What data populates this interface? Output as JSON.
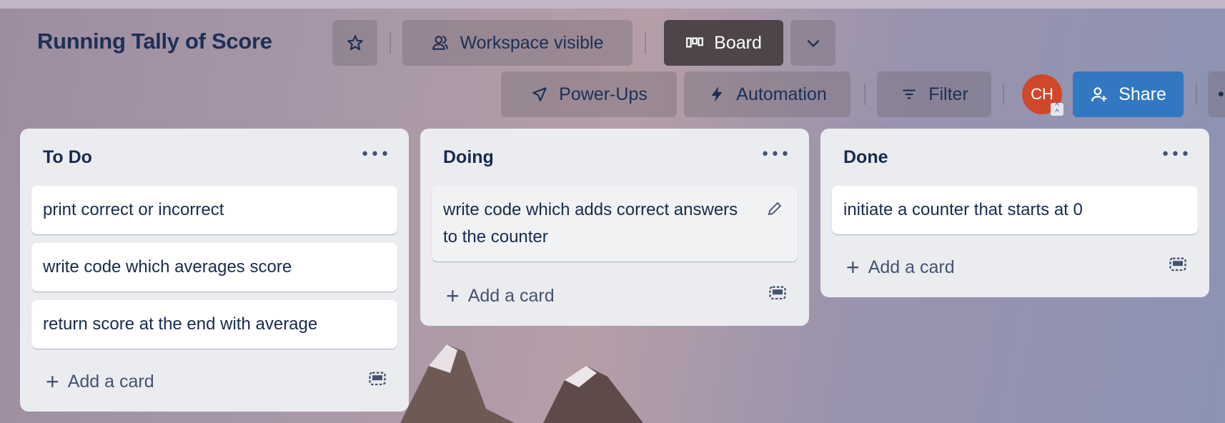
{
  "board": {
    "title": "Running Tally of Score"
  },
  "header": {
    "star_icon": "star-icon",
    "visibility_label": "Workspace visible",
    "view_label": "Board",
    "powerups_label": "Power-Ups",
    "automation_label": "Automation",
    "filter_label": "Filter",
    "avatar_initials": "CH",
    "share_label": "Share",
    "colors": {
      "share": "#3278c0",
      "avatar": "#d0482a",
      "view": "#4d4549"
    }
  },
  "lists": [
    {
      "title": "To Do",
      "cards": [
        "print correct or incorrect",
        "write code which averages score",
        "return score at the end with average"
      ],
      "add_label": "Add a card"
    },
    {
      "title": "Doing",
      "cards": [
        "write code which adds correct answers to the counter"
      ],
      "add_label": "Add a card"
    },
    {
      "title": "Done",
      "cards": [
        "initiate a counter that starts at 0"
      ],
      "add_label": "Add a card"
    }
  ]
}
